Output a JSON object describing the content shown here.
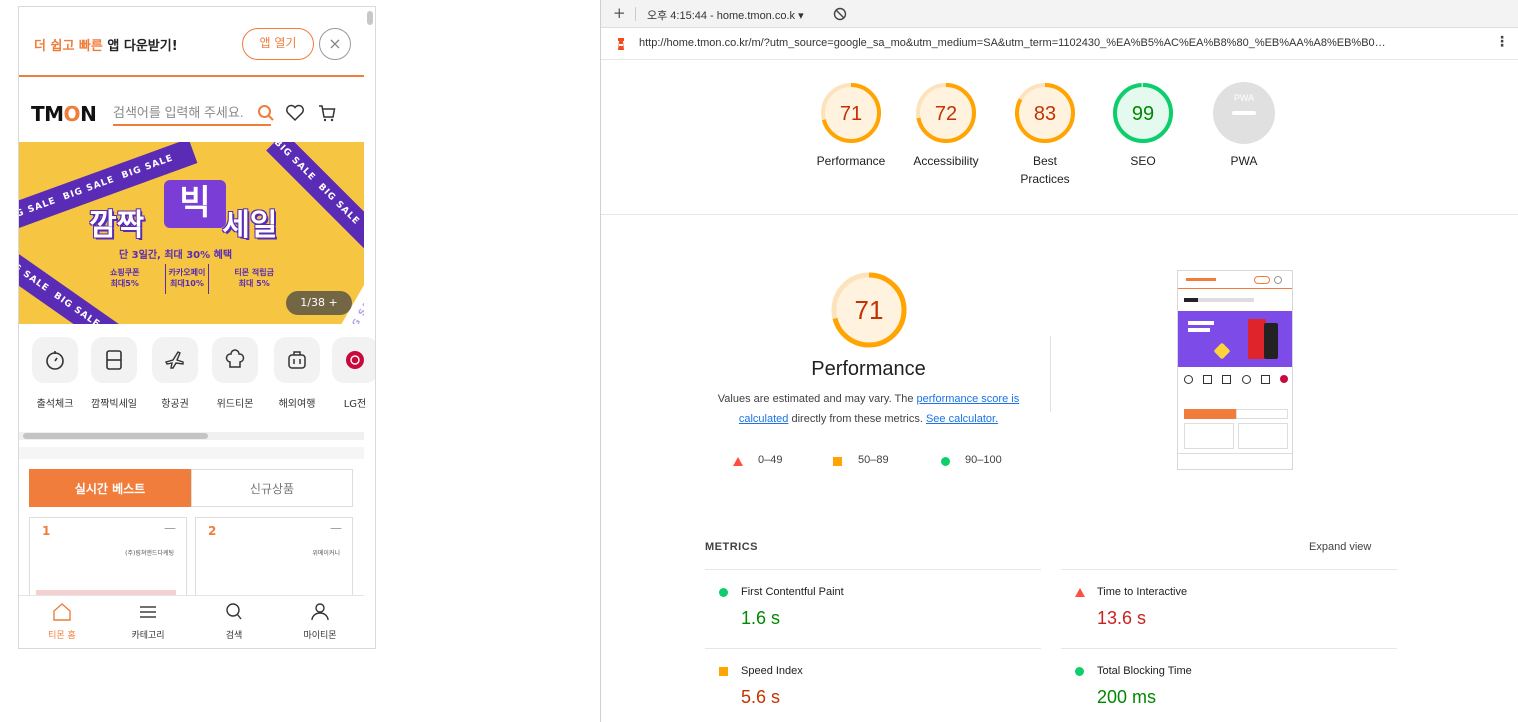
{
  "mobile": {
    "app_banner": {
      "text_accent": "더 쉽고 빠른",
      "text_rest": "앱 다운받기!",
      "open_label": "앱 열기",
      "close_glyph": "×"
    },
    "header": {
      "logo_prefix": "TM",
      "logo_o": "O",
      "logo_suffix": "N",
      "search_placeholder": "검색어를 입력해 주세요."
    },
    "promo": {
      "title_left": "깜짝",
      "title_big": "빅",
      "title_right": "세일",
      "subtitle": "단 3일간, 최대 30% 혜택",
      "stripe_text": "BIG SALE",
      "chips": [
        {
          "line1": "쇼핑쿠폰",
          "line2": "최대5%"
        },
        {
          "line1": "카카오페이",
          "line2": "최대10%"
        },
        {
          "line1": "티몬 적립금",
          "line2": "최대 5%"
        }
      ],
      "counter": "1/38 +"
    },
    "categories": [
      {
        "label": "출석체크",
        "icon": "stopwatch-icon"
      },
      {
        "label": "깜짝빅세일",
        "icon": "panel-icon"
      },
      {
        "label": "항공권",
        "icon": "airplane-icon"
      },
      {
        "label": "위드티몬",
        "icon": "chef-hat-icon"
      },
      {
        "label": "해외여행",
        "icon": "suitcase-icon"
      },
      {
        "label": "LG전",
        "icon": "lg-logo-icon"
      }
    ],
    "tabs": [
      {
        "label": "실시간 베스트"
      },
      {
        "label": "신규상품"
      }
    ],
    "cards": [
      {
        "num": "1",
        "dash": "—",
        "text": "(주)림쳐앤드다케팅"
      },
      {
        "num": "2",
        "dash": "—",
        "text": "위메이커니"
      }
    ],
    "bottom_nav": [
      {
        "label": "티몬 홈",
        "icon": "home-icon"
      },
      {
        "label": "카테고리",
        "icon": "menu-icon"
      },
      {
        "label": "검색",
        "icon": "search-icon"
      },
      {
        "label": "마이티몬",
        "icon": "person-icon"
      }
    ]
  },
  "devtools": {
    "report_selector": "오후 4:15:44 - home.tmon.co.k ▾",
    "url": "http://home.tmon.co.kr/m/?utm_source=google_sa_mo&utm_medium=SA&utm_term=1102430_%EA%B5%AC%EA%B8%80_%EB%AA%A8%EB%B0…",
    "categories": [
      {
        "score": "71",
        "label": "Performance",
        "color": "#ffa400",
        "text_color": "#c33300"
      },
      {
        "score": "72",
        "label": "Accessibility",
        "color": "#ffa400",
        "text_color": "#c33300"
      },
      {
        "score": "83",
        "label": "Best Practices",
        "color": "#ffa400",
        "text_color": "#c33300"
      },
      {
        "score": "99",
        "label": "SEO",
        "color": "#0cce6b",
        "text_color": "#008800"
      },
      {
        "score": "PWA",
        "label": "PWA",
        "color": "#cccccc",
        "text_color": "#ffffff"
      }
    ],
    "performance": {
      "score": "71",
      "title": "Performance",
      "desc_1": "Values are estimated and may vary. The ",
      "desc_link1": "performance score is calculated",
      "desc_2": " directly from these metrics. ",
      "desc_link2": "See calculator."
    },
    "legend": [
      {
        "range": "0–49",
        "color": "#ff4e42"
      },
      {
        "range": "50–89",
        "color": "#ffa400"
      },
      {
        "range": "90–100",
        "color": "#0cce6b"
      }
    ],
    "metrics_header": "METRICS",
    "expand_view": "Expand view",
    "metrics": [
      {
        "name": "First Contentful Paint",
        "value": "1.6 s",
        "status": "pass",
        "color": "#0cce6b",
        "value_color": "#008800"
      },
      {
        "name": "Time to Interactive",
        "value": "13.6 s",
        "status": "fail",
        "color": "#ff4e42",
        "value_color": "#c7221f"
      },
      {
        "name": "Speed Index",
        "value": "5.6 s",
        "status": "average",
        "color": "#ffa400",
        "value_color": "#c33300"
      },
      {
        "name": "Total Blocking Time",
        "value": "200 ms",
        "status": "pass",
        "color": "#0cce6b",
        "value_color": "#008800"
      }
    ]
  }
}
